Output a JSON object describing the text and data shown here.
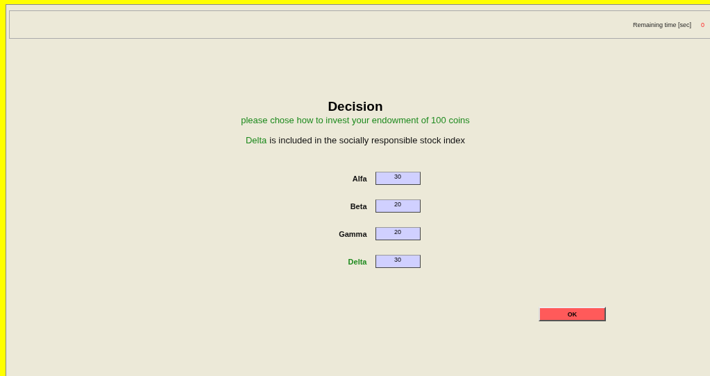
{
  "header": {
    "remaining_label": "Remaining time [sec]",
    "remaining_value": "0"
  },
  "title": "Decision",
  "subtitle": "please chose how to invest your endowment of 100 coins",
  "info": {
    "highlight": "Delta",
    "text": "is included in the socially responsible stock index"
  },
  "assets": [
    {
      "name": "Alfa",
      "value": "30",
      "highlighted": false
    },
    {
      "name": "Beta",
      "value": "20",
      "highlighted": false
    },
    {
      "name": "Gamma",
      "value": "20",
      "highlighted": false
    },
    {
      "name": "Delta",
      "value": "30",
      "highlighted": true
    }
  ],
  "ok_button": "OK"
}
